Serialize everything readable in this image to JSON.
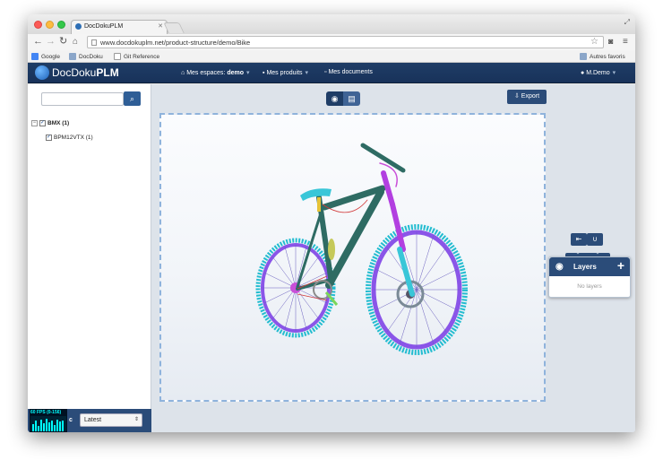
{
  "browser": {
    "tab_title": "DocDokuPLM",
    "tab_close": "✕",
    "url": "www.docdokuplm.net/product-structure/demo/Bike",
    "bookmarks": [
      "Google",
      "DocDoku",
      "Git Reference"
    ],
    "other_bookmarks": "Autres favoris"
  },
  "app": {
    "logo_text": "DocDoku",
    "logo_bold": "PLM",
    "menu": {
      "workspaces_label": "Mes espaces:",
      "workspace_name": "demo",
      "products": "Mes produits",
      "documents": "Mes documents",
      "user": "M.Demo"
    }
  },
  "sidebar": {
    "search_placeholder": "",
    "tree": [
      {
        "label": "BMX (1)",
        "checked": true,
        "expanded": true
      },
      {
        "label": "BPM12VTX (1)",
        "checked": true
      }
    ],
    "fps_label": "60 FPS (0-156)",
    "fps_readout_partial": "c",
    "version_select": "Latest"
  },
  "viewer": {
    "export_label": "Export",
    "layers_title": "Layers",
    "layers_empty": "No layers"
  },
  "colors": {
    "header": "#1f3d66",
    "accent": "#2b4c79",
    "frame": "#2e6b63",
    "tire": "#23bcd0",
    "rim": "#8a55e8",
    "fork": "#b23fe0",
    "saddle": "#39c6d8"
  }
}
